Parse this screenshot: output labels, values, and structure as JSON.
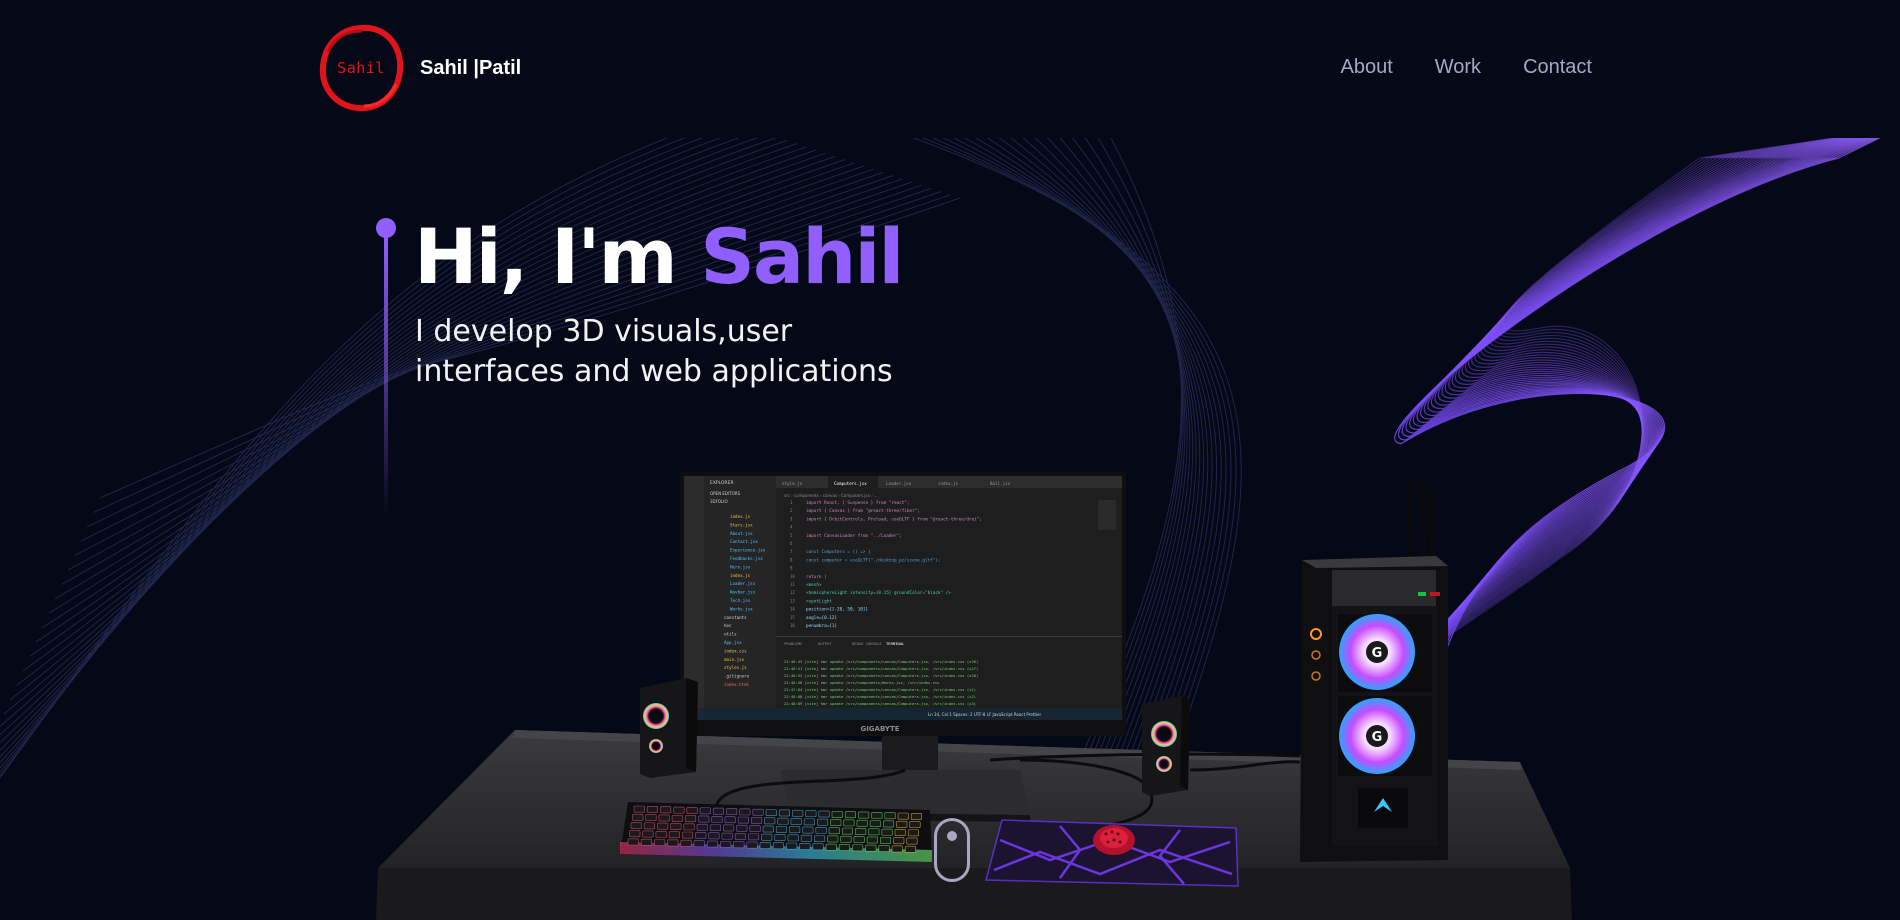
{
  "navbar": {
    "logo_text": "Sahil",
    "brand_name": "Sahil |Patil",
    "links": [
      {
        "label": "About"
      },
      {
        "label": "Work"
      },
      {
        "label": "Contact"
      }
    ]
  },
  "hero": {
    "title_prefix": "Hi, I'm ",
    "title_name": "Sahil",
    "subtitle_line1": "I develop 3D visuals,user",
    "subtitle_line2": "interfaces and web applications"
  },
  "scene": {
    "monitor_brand": "GIGABYTE",
    "editor_tabs": [
      "style.js",
      "Computers.jsx",
      "Loader.jsx",
      "index.js",
      "Ball.jsx"
    ],
    "panel_tabs": [
      "PROBLEMS",
      "OUTPUT",
      "DEBUG CONSOLE",
      "TERMINAL"
    ],
    "code_lines": [
      "import React, { Suspense } from \"react\";",
      "import { Canvas } from \"@react-three/fiber\";",
      "import { OrbitControls, Preload, useGLTF } from \"@react-three/drei\";",
      "",
      "import CanvasLoader from \"../Loader\";",
      "",
      "const Computers = () => {",
      "  const computer = useGLTF(\"./desktop_pc/scene.gltf\");",
      "",
      "  return (",
      "    <mesh>",
      "      <hemisphereLight intensity={0.15} groundColor=\"black\" />",
      "      <spotLight",
      "        position={[-20, 50, 10]}",
      "        angle={0.12}",
      "        penumbra={1}"
    ],
    "file_tree": [
      "index.js",
      "Stars.jsx",
      "About.jsx",
      "Contact.jsx",
      "Experience.jsx",
      "Feedbacks.jsx",
      "Hero.jsx",
      "index.js",
      "Loader.jsx",
      "Navbar.jsx",
      "Tech.jsx",
      "Works.jsx",
      "constants",
      "hoc",
      "utils",
      "App.jsx",
      "index.css",
      "main.jsx",
      "styles.js",
      ".gitignore",
      "index.html"
    ],
    "terminal_lines": [
      "22:46:43 [vite] hmr update /src/components/canvas/Computers.jsx, /src/index.css (x26)",
      "22:46:51 [vite] hmr update /src/components/canvas/Computers.jsx, /src/index.css (x27)",
      "22:46:52 [vite] hmr update /src/components/canvas/Computers.jsx, /src/index.css (x28)",
      "22:46:56 [vite] hmr update /src/components/Works.jsx, /src/index.css",
      "22:47:04 [vite] hmr update /src/components/canvas/Computers.jsx, /src/index.css (x1)",
      "22:48:08 [vite] hmr update /src/components/canvas/Computers.jsx, /src/index.css (x2)",
      "22:48:09 [vite] hmr update /src/components/canvas/Computers.jsx, /src/index.css (x3)"
    ],
    "status_bar": "Ln 34, Col 1   Spaces: 2   UTF-8   LF   JavaScript React   Prettier"
  },
  "colors": {
    "background": "#050816",
    "accent": "#915eff",
    "nav_text": "#aaa6c3",
    "logo_red": "#e1141c"
  }
}
